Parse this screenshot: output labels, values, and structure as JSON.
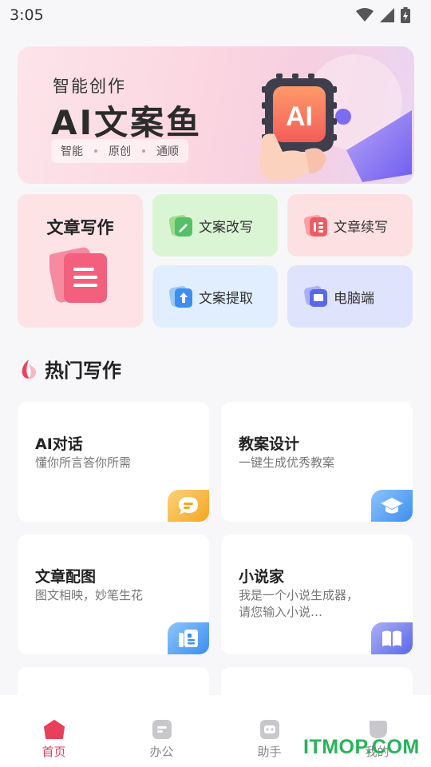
{
  "status_bar": {
    "time": "3:05"
  },
  "banner": {
    "subtitle": "智能创作",
    "title": "AI文案鱼",
    "tags": [
      "智能",
      "原创",
      "通顺"
    ],
    "chip_text": "AI"
  },
  "features": {
    "article_writing": "文章写作",
    "copy_rewrite": "文案改写",
    "article_continue": "文章续写",
    "copy_extract": "文案提取",
    "pc_client": "电脑端"
  },
  "section": {
    "title": "热门写作"
  },
  "cards": [
    {
      "title": "AI对话",
      "desc": "懂你所言答你所需",
      "icon": "chat-icon",
      "color": "#f5a623"
    },
    {
      "title": "教案设计",
      "desc": "一键生成优秀教案",
      "icon": "graduation-cap-icon",
      "color": "#3d8ef0"
    },
    {
      "title": "文章配图",
      "desc": "图文相映，妙笔生花",
      "icon": "article-image-icon",
      "color": "#3d8ef0"
    },
    {
      "title": "小说家",
      "desc": "我是一个小说生成器，请您输入小说…",
      "icon": "book-icon",
      "color": "#5a67e8"
    }
  ],
  "tabbar": {
    "home": "首页",
    "office": "办公",
    "assistant": "助手",
    "mine": "我的"
  },
  "watermark": "ITMOP.COM",
  "colors": {
    "accent": "#e8405a",
    "background": "#f7f7f9"
  }
}
